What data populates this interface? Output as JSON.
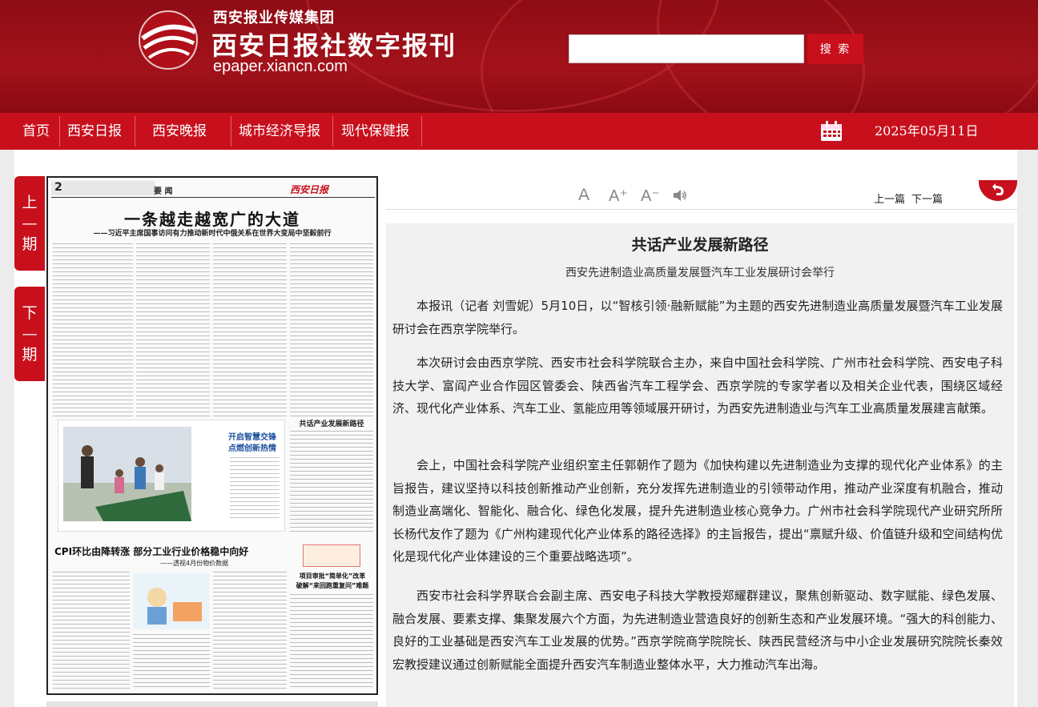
{
  "header": {
    "group_name": "西安报业传媒集团",
    "site_title": "西安日报社数字报刊",
    "domain": "epaper.xiancn.com",
    "search": {
      "placeholder": "",
      "button_label": "搜 索"
    }
  },
  "nav": {
    "items": [
      {
        "label": "首页"
      },
      {
        "label": "西安日报"
      },
      {
        "label": "西安晚报"
      },
      {
        "label": "城市经济导报"
      },
      {
        "label": "现代保健报"
      }
    ],
    "date": "2025年05月11日"
  },
  "issue_nav": {
    "prev": [
      "上",
      "期"
    ],
    "next": [
      "下",
      "期"
    ]
  },
  "toolbar": {
    "font_large": "A",
    "font_plus": "A⁺",
    "font_minus": "A⁻",
    "speaker_icon": "speaker-icon",
    "prev_article": "上一篇",
    "next_article": "下一篇",
    "back_icon": "return-icon"
  },
  "thumbnail": {
    "page_number": "2",
    "section": "要  闻",
    "masthead": "西安日报",
    "headline": "一条越走越宽广的大道",
    "subhead": "——习近平主席国事访问有力推动新时代中俄关系在世界大变局中坚毅前行",
    "photo_caption_1": "开启智慧交锋",
    "photo_caption_2": "点燃创新热情",
    "article_title": "共话产业发展新路径",
    "cpi_headline": "CPI环比由降转涨  部分工业行业价格稳中向好",
    "cpi_subhead": "——透视4月份物价数据",
    "side_headline": "项目审批“简单化”改革",
    "side_subhead": "破解“来回跑重复问”难题"
  },
  "article": {
    "title": "共话产业发展新路径",
    "subtitle": "西安先进制造业高质量发展暨汽车工业发展研讨会举行",
    "paragraphs": [
      "本报讯（记者 刘雪妮）5月10日，以“智核引领·融新赋能”为主题的西安先进制造业高质量发展暨汽车工业发展研讨会在西京学院举行。",
      "本次研讨会由西京学院、西安市社会科学院联合主办，来自中国社会科学院、广州市社会科学院、西安电子科技大学、富阎产业合作园区管委会、陕西省汽车工程学会、西京学院的专家学者以及相关企业代表，围绕区域经济、现代化产业体系、汽车工业、氢能应用等领域展开研讨，为西安先进制造业与汽车工业高质量发展建言献策。",
      "会上，中国社会科学院产业组织室主任郭朝作了题为《加快构建以先进制造业为支撑的现代化产业体系》的主旨报告，建议坚持以科技创新推动产业创新，充分发挥先进制造业的引领带动作用，推动产业深度有机融合，推动制造业高端化、智能化、融合化、绿色化发展，提升先进制造业核心竞争力。广州市社会科学院现代产业研究所所长杨代友作了题为《广州构建现代化产业体系的路径选择》的主旨报告，提出“禀赋升级、价值链升级和空间结构优化是现代化产业体建设的三个重要战略选项”。",
      "西安市社会科学界联合会副主席、西安电子科技大学教授郑耀群建议，聚焦创新驱动、数字赋能、绿色发展、融合发展、要素支撑、集聚发展六个方面，为先进制造业营造良好的创新生态和产业发展环境。“强大的科创能力、良好的工业基础是西安汽车工业发展的优势。”西京学院商学院院长、陕西民营经济与中小企业发展研究院院长秦效宏教授建议通过创新赋能全面提升西安汽车制造业整体水平，大力推动汽车出海。"
    ]
  },
  "colors": {
    "brand_red": "#c8101d",
    "header_dark": "#8e0c14"
  }
}
